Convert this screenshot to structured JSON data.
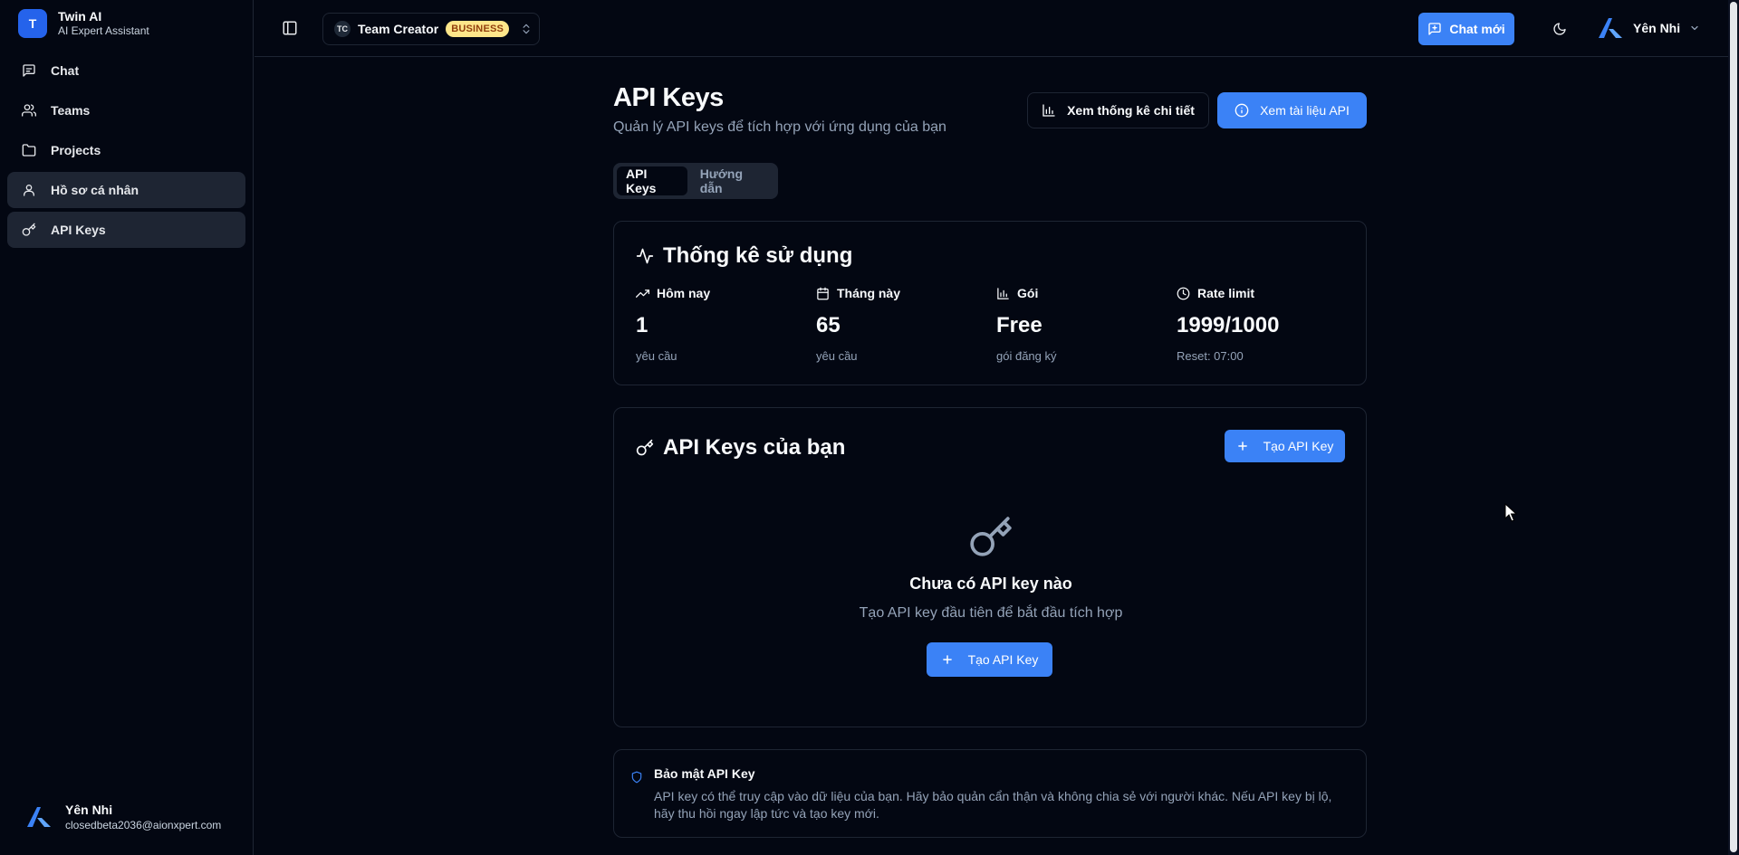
{
  "brand": {
    "logo_letter": "T",
    "name": "Twin AI",
    "subtitle": "AI Expert Assistant"
  },
  "sidebar": {
    "items": [
      {
        "label": "Chat",
        "icon": "message-square-icon",
        "active": false
      },
      {
        "label": "Teams",
        "icon": "users-icon",
        "active": false
      },
      {
        "label": "Projects",
        "icon": "folder-icon",
        "active": false
      },
      {
        "label": "Hồ sơ cá nhân",
        "icon": "user-icon",
        "active": true
      },
      {
        "label": "API Keys",
        "icon": "key-icon",
        "active": true
      }
    ],
    "user": {
      "name": "Yên Nhi",
      "email": "closedbeta2036@aionxpert.com"
    }
  },
  "topbar": {
    "team": {
      "initials": "TC",
      "name": "Team Creator",
      "badge": "BUSINESS"
    },
    "new_chat_label": "Chat mới",
    "user_name": "Yên Nhi"
  },
  "page": {
    "title": "API Keys",
    "subtitle": "Quản lý API keys để tích hợp với ứng dụng của bạn",
    "stats_button": "Xem thống kê chi tiết",
    "docs_button": "Xem tài liệu API",
    "tabs": [
      {
        "label": "API Keys",
        "active": true
      },
      {
        "label": "Hướng dẫn",
        "active": false
      }
    ]
  },
  "usage": {
    "title": "Thống kê sử dụng",
    "stats": [
      {
        "label": "Hôm nay",
        "value": "1",
        "sub": "yêu cầu",
        "icon": "trending-up-icon"
      },
      {
        "label": "Tháng này",
        "value": "65",
        "sub": "yêu cầu",
        "icon": "calendar-icon"
      },
      {
        "label": "Gói",
        "value": "Free",
        "sub": "gói đăng ký",
        "icon": "bar-chart-icon"
      },
      {
        "label": "Rate limit",
        "value": "1999/1000",
        "sub": "Reset: 07:00",
        "icon": "clock-icon"
      }
    ]
  },
  "keys": {
    "title": "API Keys của bạn",
    "create_label": "Tạo API Key",
    "empty_title": "Chưa có API key nào",
    "empty_sub": "Tạo API key đầu tiên để bắt đầu tích hợp",
    "empty_create_label": "Tạo API Key"
  },
  "security": {
    "title": "Bảo mật API Key",
    "text": "API key có thể truy cập vào dữ liệu của bạn. Hãy bảo quản cẩn thận và không chia sẻ với người khác. Nếu API key bị lộ, hãy thu hồi ngay lập tức và tạo key mới."
  },
  "colors": {
    "accent": "#3b82f6",
    "background": "#030712",
    "border": "#1e2533",
    "badge_bg": "#fde68a",
    "badge_text": "#92400e"
  }
}
